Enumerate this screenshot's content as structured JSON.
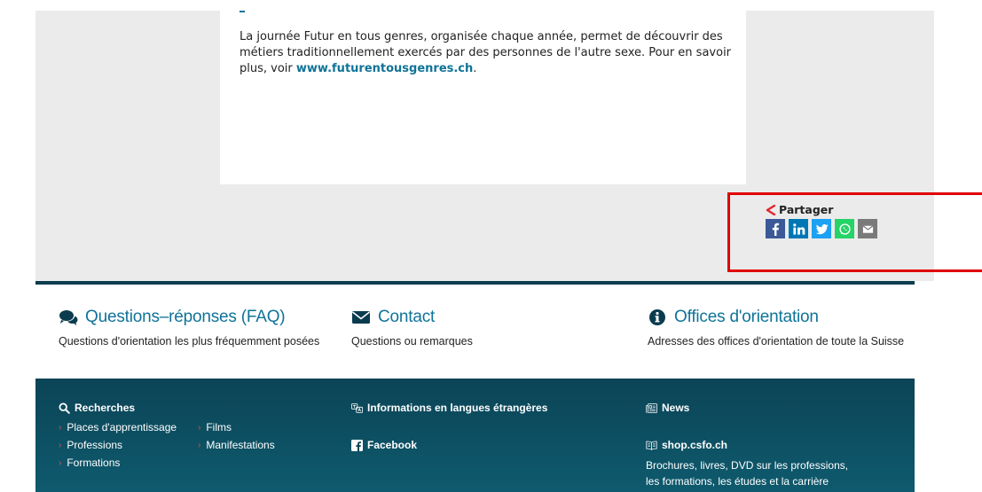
{
  "article": {
    "text": "La journée Futur en tous genres, organisée chaque année, permet de découvrir des métiers traditionnellement exercés par des personnes de l'autre sexe. Pour en savoir plus, voir ",
    "link_text": "www.futurentousgenres.ch",
    "link_suffix": "."
  },
  "share": {
    "title": "Partager",
    "icons": [
      "facebook-icon",
      "linkedin-icon",
      "twitter-icon",
      "whatsapp-icon",
      "email-icon"
    ]
  },
  "quick_links": [
    {
      "icon": "comments-icon",
      "title": "Questions–réponses (FAQ)",
      "desc": "Questions d'orientation les plus fréquemment posées"
    },
    {
      "icon": "envelope-icon",
      "title": "Contact",
      "desc": "Questions ou remarques"
    },
    {
      "icon": "info-icon",
      "title": "Offices d'orientation",
      "desc": "Adresses des offices d'orientation de toute la Suisse"
    }
  ],
  "footer": {
    "search": {
      "title": "Recherches",
      "items": [
        "Places d'apprentissage",
        "Films",
        "Professions",
        "Manifestations",
        "Formations"
      ]
    },
    "languages": {
      "title": "Informations en langues étrangères"
    },
    "facebook": {
      "title": "Facebook"
    },
    "news": {
      "title": "News"
    },
    "shop": {
      "title": "shop.csfo.ch",
      "desc_line1": "Brochures, livres, DVD sur les professions,",
      "desc_line2": "les formations, les études et la carrière"
    }
  },
  "colors": {
    "accent": "#0f7399",
    "footer_bg": "#0b4456",
    "highlight_box": "#e00000",
    "share_icon": "#e0282e"
  }
}
